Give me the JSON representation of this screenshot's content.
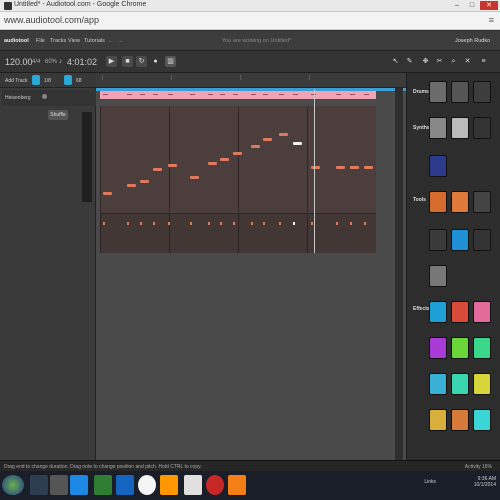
{
  "browser": {
    "title": "Untitled* - Audiotool.com - Google Chrome",
    "url": "www.audiotool.com/app",
    "window_buttons": [
      "–",
      "□",
      "✕"
    ]
  },
  "app_menu": {
    "logo": "audiotool",
    "items": [
      "File",
      "Tracks",
      "View",
      "Tutorials"
    ],
    "status": "You are working on Untitled*",
    "user": "Joseph Rudko"
  },
  "transport": {
    "tempo": "120.00",
    "signature": "4/4",
    "percent": "60%",
    "time": "4:01:02"
  },
  "toolbar": {
    "add_track": "Add Track",
    "quantize": "1/8"
  },
  "tracks": {
    "track_name": "Heisenberg",
    "shuffle": "Shuffle"
  },
  "devices": {
    "sections": [
      "Drums",
      "Synths",
      "Tools",
      "Effects"
    ]
  },
  "status": {
    "hint": "Drag end to change duration. Drag note to change position and pitch. Hold CTRL to copy.",
    "activity": "Activity 16%"
  },
  "taskbar": {
    "links": "Links",
    "clock_time": "9:36 AM",
    "clock_date": "10/1/2014"
  }
}
